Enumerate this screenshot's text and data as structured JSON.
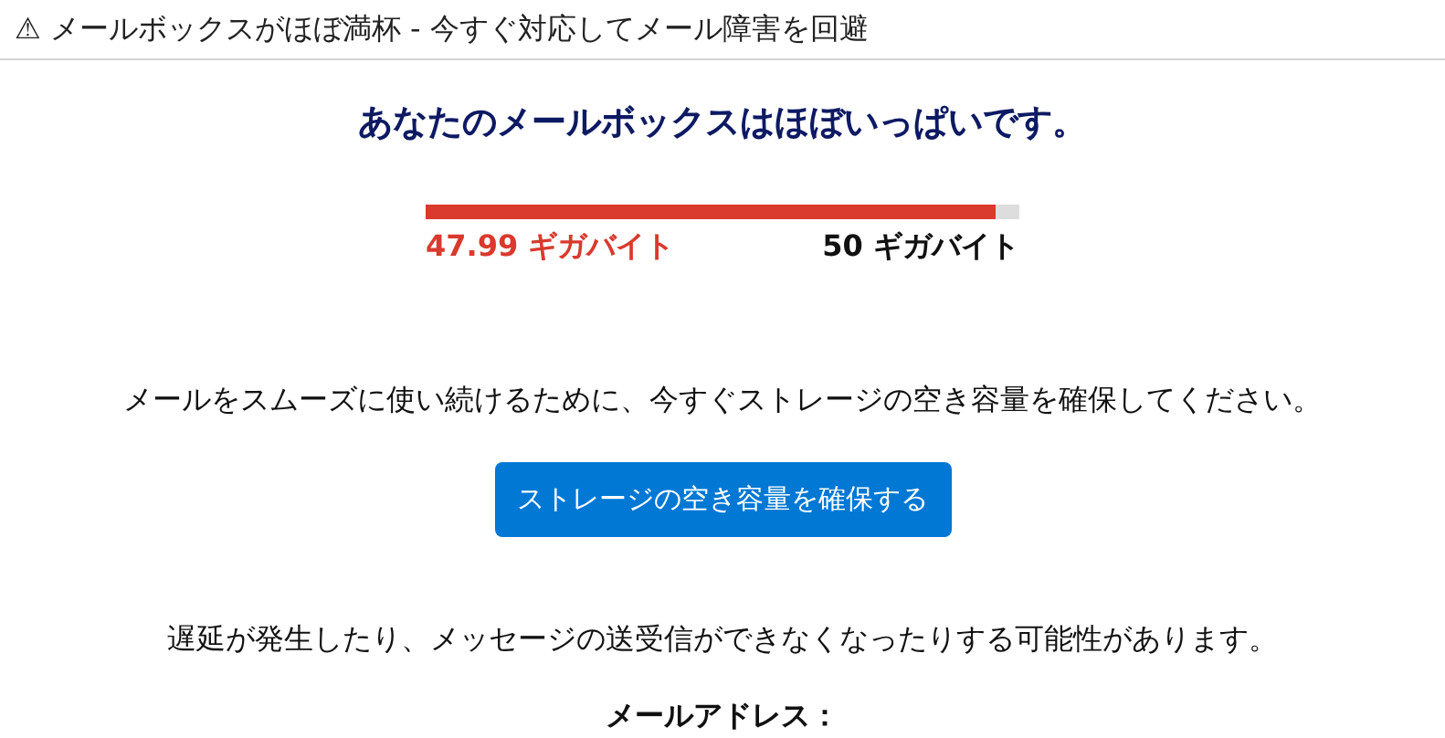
{
  "subject": "⚠ メールボックスがほぼ満杯 - 今すぐ対応してメール障害を回避",
  "heading": "あなたのメールボックスはほぼいっぱいです。",
  "storage": {
    "level": 0.96,
    "used": "47.99 ギガバイト",
    "total": "50 ギガバイト"
  },
  "message": "メールをスムーズに使い続けるために、今すぐストレージの空き容量を確保してください。",
  "button": "ストレージの空き容量を確保する",
  "warning": "遅延が発生したり、メッセージの送受信ができなくなったりする可能性があります。",
  "address_label": "メールアドレス："
}
